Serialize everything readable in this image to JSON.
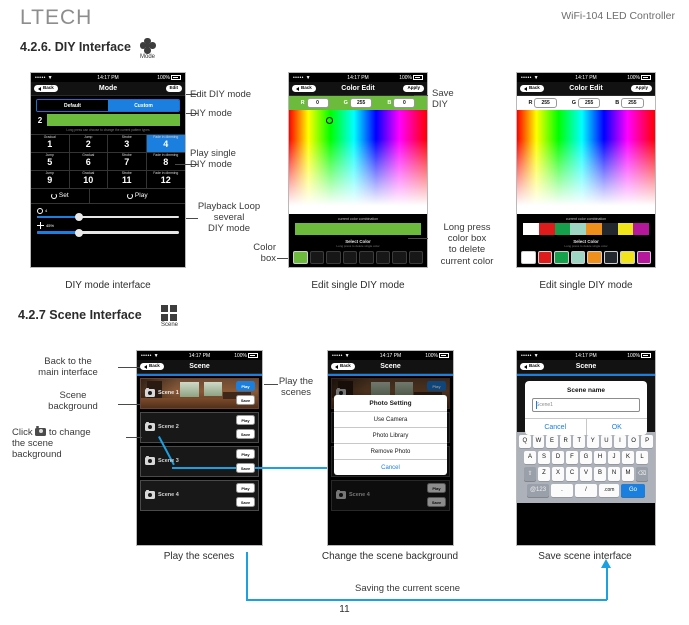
{
  "header": {
    "brand": "LTECH",
    "doc_title": "WiFi-104 LED Controller"
  },
  "sections": {
    "diy": {
      "heading": "4.2.6. DIY Interface",
      "icon_caption": "Mode",
      "icon": "mode-flower-icon"
    },
    "scene": {
      "heading": "4.2.7 Scene Interface",
      "icon_caption": "Scene",
      "icon": "scene-grid-icon"
    }
  },
  "status_bar": {
    "carrier": "•••••",
    "wifi": "▼",
    "time": "14:17 PM",
    "battery": "100%"
  },
  "phone_diy": {
    "nav": {
      "back": "Back",
      "title": "Mode",
      "right": "Edit"
    },
    "segments": [
      {
        "label": "Default",
        "selected": false
      },
      {
        "label": "Custom",
        "selected": true
      }
    ],
    "current": {
      "number": "2",
      "color": "#6dbb3c"
    },
    "hint": "Long press can choose to change the current pattern types",
    "modes": [
      {
        "type": "Gradual",
        "num": "1",
        "selected": false
      },
      {
        "type": "Jump",
        "num": "2",
        "selected": false
      },
      {
        "type": "Strobe",
        "num": "3",
        "selected": false
      },
      {
        "type": "Fade in dimming",
        "num": "4",
        "selected": true
      },
      {
        "type": "Jump",
        "num": "5",
        "selected": false
      },
      {
        "type": "Gradual",
        "num": "6",
        "selected": false
      },
      {
        "type": "Strobe",
        "num": "7",
        "selected": false
      },
      {
        "type": "Fade in dimming",
        "num": "8",
        "selected": false
      },
      {
        "type": "Jump",
        "num": "9",
        "selected": false
      },
      {
        "type": "Gradual",
        "num": "10",
        "selected": false
      },
      {
        "type": "Strobe",
        "num": "11",
        "selected": false
      },
      {
        "type": "Fade in dimming",
        "num": "12",
        "selected": false
      }
    ],
    "actions": {
      "set": "Set",
      "play": "Play"
    },
    "sliders": [
      {
        "icon": "speed-icon",
        "value": "4",
        "percent": 30
      },
      {
        "icon": "brightness-icon",
        "value": "45%",
        "percent": 30
      }
    ]
  },
  "phone_color_single": {
    "nav": {
      "back": "Back",
      "title": "Color Edit",
      "right": "Apply"
    },
    "rgb": {
      "r_label": "R",
      "r": "0",
      "g_label": "G",
      "g": "255",
      "b_label": "B",
      "b": "0"
    },
    "combination_label": "current color combination",
    "combination_colors": [
      "#6dbb3c"
    ],
    "select_label": "Select Color",
    "select_sub": "Long press to delete single color",
    "swatches": [
      "#6dbb3c",
      "",
      "",
      "",
      "",
      "",
      "",
      ""
    ]
  },
  "phone_color_multi": {
    "nav": {
      "back": "Back",
      "title": "Color Edit",
      "right": "Apply"
    },
    "rgb": {
      "r_label": "R",
      "r": "255",
      "g_label": "G",
      "g": "255",
      "b_label": "B",
      "b": "255"
    },
    "combination_label": "current color combination",
    "combination_colors": [
      "#ffffff",
      "#e01b1b",
      "#16a04c",
      "#9ed6c4",
      "#f0901c",
      "#22272e",
      "#f2e41b",
      "#b5189a"
    ],
    "select_label": "Select Color",
    "select_sub": "Long press to delete single color",
    "swatches": [
      "#ffffff",
      "#e01b1b",
      "#16a04c",
      "#9ed6c4",
      "#f0901c",
      "#22272e",
      "#f2e41b",
      "#b5189a"
    ]
  },
  "phone_scene_list": {
    "nav": {
      "back": "Back",
      "title": "Scene"
    },
    "scenes": [
      {
        "name": "Scene 1",
        "has_photo": true,
        "play": "Play",
        "save": "Save",
        "play_active": true
      },
      {
        "name": "Scene 2",
        "has_photo": false,
        "play": "Play",
        "save": "Save",
        "play_active": false
      },
      {
        "name": "Scene 3",
        "has_photo": false,
        "play": "Play",
        "save": "Save",
        "play_active": false
      },
      {
        "name": "Scene 4",
        "has_photo": false,
        "play": "Play",
        "save": "Save",
        "play_active": false
      }
    ]
  },
  "phone_scene_photo": {
    "nav": {
      "back": "Back",
      "title": "Scene"
    },
    "sheet": {
      "title": "Photo Setting",
      "options": [
        "Use Camera",
        "Photo Library",
        "Remove Photo"
      ],
      "cancel": "Cancel"
    },
    "background_scene": {
      "name": "Scene 4",
      "play": "Play",
      "save": "Save"
    }
  },
  "phone_scene_save": {
    "nav": {
      "back": "Back",
      "title": "Scene"
    },
    "dialog": {
      "title": "Scene name",
      "input_value": "Scene1",
      "cancel": "Cancel",
      "ok": "OK"
    },
    "keyboard": {
      "row1": [
        "Q",
        "W",
        "E",
        "R",
        "T",
        "Y",
        "U",
        "I",
        "O",
        "P"
      ],
      "row2": [
        "A",
        "S",
        "D",
        "F",
        "G",
        "H",
        "J",
        "K",
        "L"
      ],
      "row3": [
        "⇧",
        "Z",
        "X",
        "C",
        "V",
        "B",
        "N",
        "M",
        "⌫"
      ],
      "row4": [
        "@123",
        ".",
        "/",
        ".com",
        "Go"
      ]
    }
  },
  "annotations": {
    "edit_diy_mode": "Edit DIY mode",
    "diy_mode": "DIY mode",
    "play_single": "Play single\nDIY mode",
    "playback_loop": "Playback Loop\nseveral\nDIY mode",
    "color_box": "Color\nbox",
    "save_diy": "Save\nDIY",
    "long_press_delete": "Long press\ncolor box\nto delete\ncurrent color",
    "back_to_main": "Back to the\nmain interface",
    "scene_background": "Scene\nbackground",
    "click_to_change": "to change\nthe scene\nbackground",
    "click_prefix": "Click",
    "play_the_scenes_right": "Play the\nscenes",
    "saving_current_scene": "Saving the current scene"
  },
  "captions": {
    "diy_mode_interface": "DIY mode interface",
    "edit_single_1": "Edit single DIY mode",
    "edit_single_2": "Edit single DIY mode",
    "play_the_scenes": "Play the scenes",
    "change_scene_bg": "Change the scene background",
    "save_scene_interface": "Save scene interface"
  },
  "page_number": "11"
}
